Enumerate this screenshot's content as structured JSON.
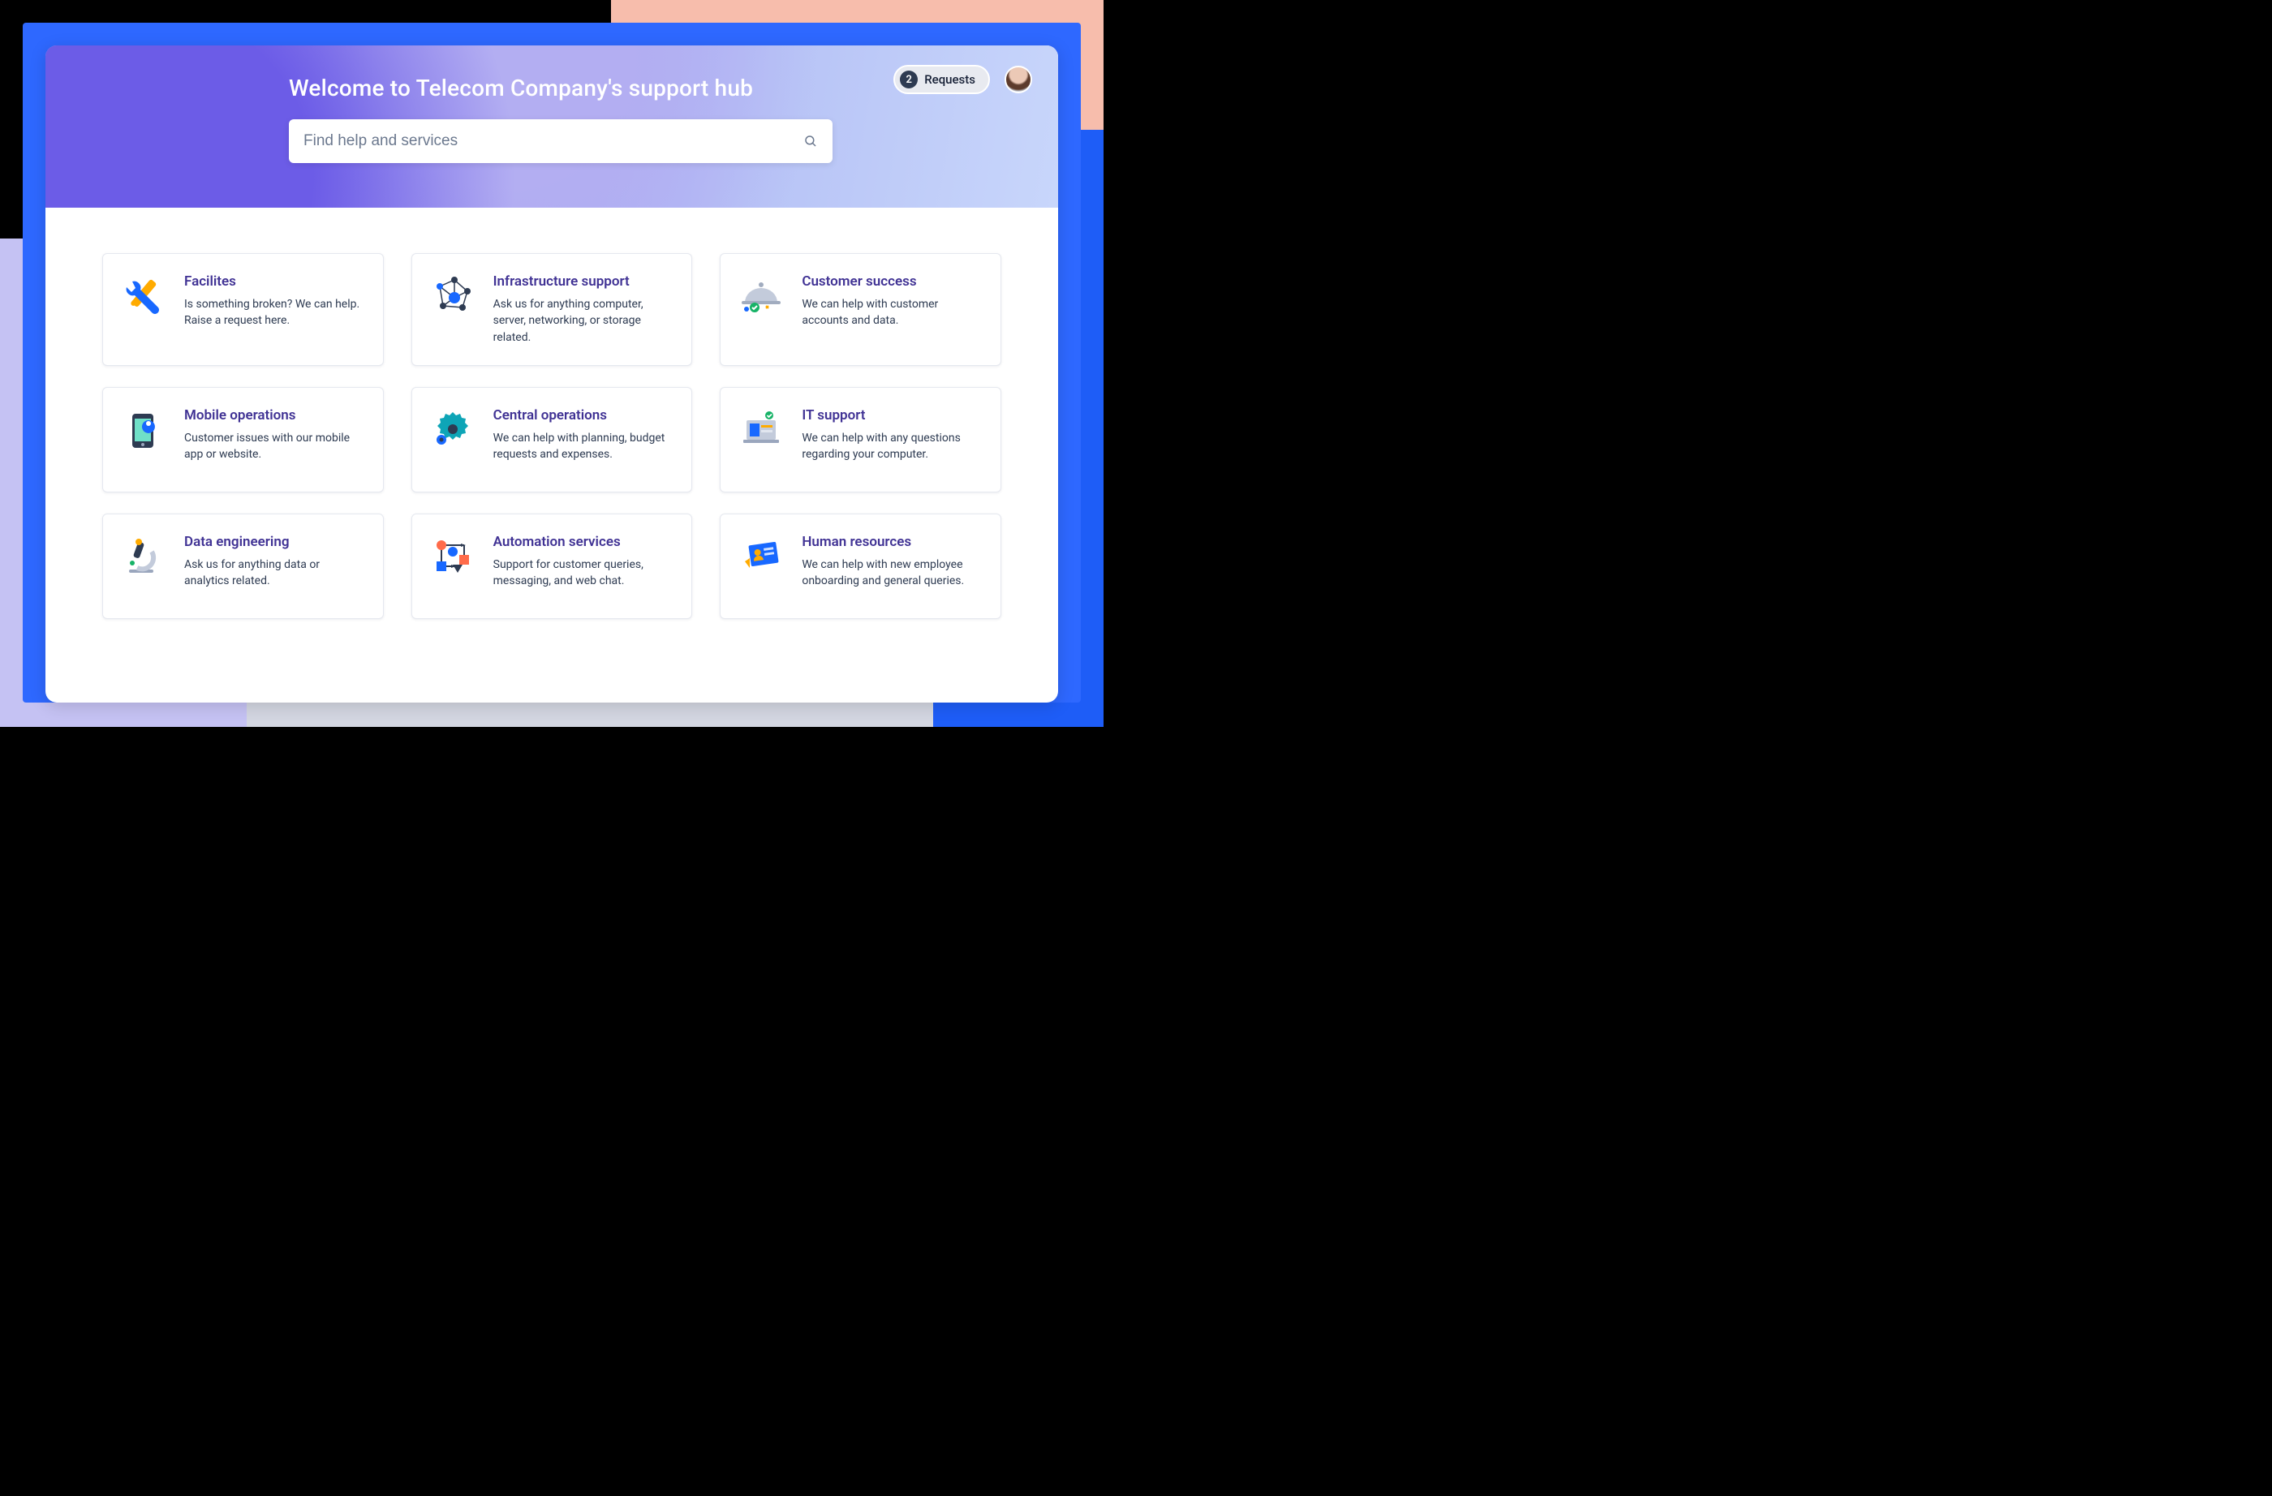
{
  "hero": {
    "title": "Welcome to Telecom Company's support hub"
  },
  "search": {
    "placeholder": "Find help and services",
    "value": ""
  },
  "requests": {
    "count": "2",
    "label": "Requests"
  },
  "colors": {
    "card_title": "#403294",
    "accent_blue": "#2e68ff",
    "peach": "#f7bdac",
    "lavender": "#c5c2f3"
  },
  "cards": [
    {
      "icon": "tools",
      "title": "Facilites",
      "desc": "Is something broken? We can help. Raise a request here."
    },
    {
      "icon": "network",
      "title": "Infrastructure support",
      "desc": "Ask us for anything computer, server, networking, or storage related."
    },
    {
      "icon": "cloche",
      "title": "Customer success",
      "desc": "We can help with customer accounts and data."
    },
    {
      "icon": "phone",
      "title": "Mobile operations",
      "desc": "Customer issues with our mobile app or website."
    },
    {
      "icon": "gear",
      "title": "Central operations",
      "desc": "We can help with planning, budget requests and expenses."
    },
    {
      "icon": "laptop",
      "title": "IT support",
      "desc": "We can help with any questions regarding your computer."
    },
    {
      "icon": "microscope",
      "title": "Data engineering",
      "desc": "Ask us for anything data or analytics related."
    },
    {
      "icon": "flowchart",
      "title": "Automation services",
      "desc": "Support for customer queries, messaging, and web chat."
    },
    {
      "icon": "badge",
      "title": "Human resources",
      "desc": "We can help with new employee onboarding and general queries."
    }
  ]
}
